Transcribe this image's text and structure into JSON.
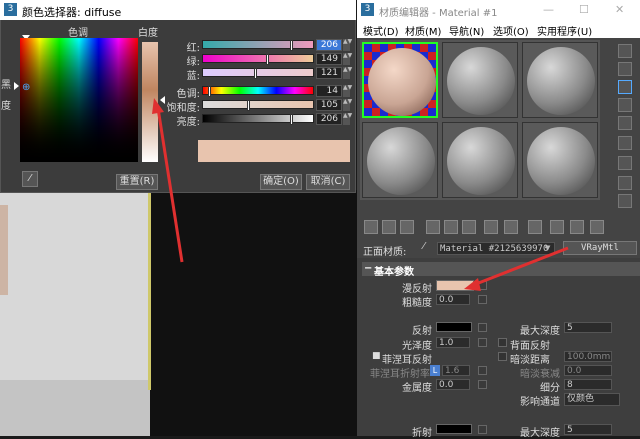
{
  "color_picker": {
    "title": "颜色选择器: diffuse",
    "hue_label": "色调",
    "whiteness_label": "白度",
    "black_label": "黑",
    "degree_label": "度",
    "channels": [
      {
        "label": "红:",
        "value": "206",
        "fill": 0.81
      },
      {
        "label": "绿:",
        "value": "149",
        "fill": 0.58
      },
      {
        "label": "蓝:",
        "value": "121",
        "fill": 0.47
      },
      {
        "label": "色调:",
        "value": "14",
        "fill": 0.05
      },
      {
        "label": "饱和度:",
        "value": "105",
        "fill": 0.41
      },
      {
        "label": "亮度:",
        "value": "206",
        "fill": 0.81
      }
    ],
    "reset_label": "重置(R)",
    "ok_label": "确定(O)",
    "cancel_label": "取消(C)",
    "swatch_color": "#e8c4ae"
  },
  "material_editor": {
    "title": "材质编辑器 - Material #1",
    "menu": [
      "模式(D)",
      "材质(M)",
      "导航(N)",
      "选项(O)",
      "实用程序(U)"
    ],
    "face_label": "正面材质:",
    "material_name": "Material #2125639970",
    "material_type": "VRayMtl",
    "rollout_title": "基本参数",
    "diffuse_label": "漫反射",
    "diffuse_color": "#e8c4ae",
    "roughness_label": "粗糙度",
    "roughness_value": "0.0",
    "reflect_label": "反射",
    "max_depth_label": "最大深度",
    "max_depth_value": "5",
    "gloss_label": "光泽度",
    "gloss_value": "1.0",
    "backreflect_label": "背面反射",
    "fresnel_label": "菲涅耳反射",
    "dimdist_label": "暗淡距离",
    "dimdist_value": "100.0mm",
    "fresnel_ior_label": "菲涅耳折射率",
    "fresnel_ior_l": "L",
    "fresnel_ior_value": "1.6",
    "dimfalloff_label": "暗淡衰减",
    "dimfalloff_value": "0.0",
    "metal_label": "金属度",
    "metal_value": "0.0",
    "subdiv_label": "细分",
    "subdiv_value": "8",
    "affect_label": "影响通道",
    "affect_value": "仅颜色",
    "refract_label": "折射",
    "max_depth2_label": "最大深度",
    "max_depth2_value": "5"
  }
}
